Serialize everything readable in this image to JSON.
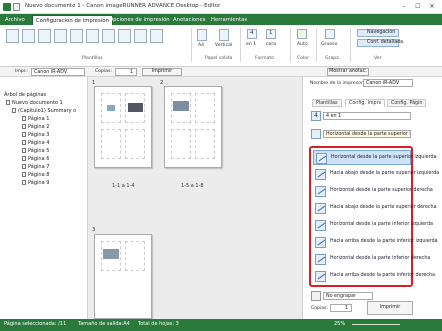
{
  "window": {
    "title": "Nuevo documento 1 - Canon imageRUNNER ADVANCE Desktop - Editor",
    "min": "–",
    "max": "☐",
    "close": "✕"
  },
  "tabs": [
    "Archivo",
    "Configuración de impresión",
    "Opciones de impresión",
    "Anotaciones",
    "Herramientas"
  ],
  "ribbon": {
    "groups": [
      "Plantillas",
      "Papel salida",
      "Formato",
      "Color",
      "Grapa",
      "Ver"
    ],
    "paper_size": "A4",
    "orientation": "Vertical",
    "pages_per_sheet": "4",
    "pages_per_sheet_sub": "en 1",
    "sides": "1",
    "sides_sub": "cara",
    "color": "Auto",
    "paper_weight": "Grueso",
    "nav_label": "Navegación",
    "detail_label": "Conf. detallada"
  },
  "toolbar": {
    "printer_label": "Impr.:",
    "printer_value": "Canon iR-ADV",
    "copies_label": "Copias:",
    "copies_value": "1",
    "print_button": "Imprimir",
    "show_annotations": "Mostrar anotac."
  },
  "tree": {
    "header": "Árbol de páginas",
    "root": "Nuevo documento 1",
    "chapter": "(Capítulo1) Summary o",
    "pages": [
      "Página 1",
      "Página 2",
      "Página 3",
      "Página 4",
      "Página 5",
      "Página 6",
      "Página 7",
      "Página 8",
      "Página 9"
    ]
  },
  "preview": {
    "sheets": [
      {
        "num": "1",
        "caption": "1-1 a 1-4"
      },
      {
        "num": "2",
        "caption": "1-5 a 1-8"
      },
      {
        "num": "3",
        "caption": ""
      }
    ]
  },
  "panel": {
    "printer_label": "Nombre de la impresora:",
    "printer_value": "Canon iR-ADV",
    "tabs": [
      "Plantillas",
      "Config. Imprv",
      "Config. Págin"
    ],
    "nup_value": "4 en 1",
    "order_value": "Horizontal desde la parte superior izq",
    "options": [
      "Horizontal desde la parte superior izquierda",
      "Hacia abajo desde la parte superior izquierda",
      "Horizontal desde la parte superior derecha",
      "Hacia abajo desde la parte superior derecha",
      "Horizontal desde la parte inferior izquierda",
      "Hacia arriba desde la parte inferior izquierda",
      "Horizontal desde la parte inferior derecha",
      "Hacia arriba desde la parte inferior derecha"
    ],
    "staple": "No engrapar",
    "copies_label": "Copias:",
    "copies_value": "1",
    "print_button": "Imprimir"
  },
  "status": {
    "selected": "Página seleccionada: /11",
    "paper": "Tamaño de salida:A4",
    "total": "Total de hojas: 3",
    "zoom": "25%"
  },
  "colors": {
    "accent": "#2a7a3c",
    "highlight": "#d61f26",
    "selection": "#cfe3f7"
  }
}
